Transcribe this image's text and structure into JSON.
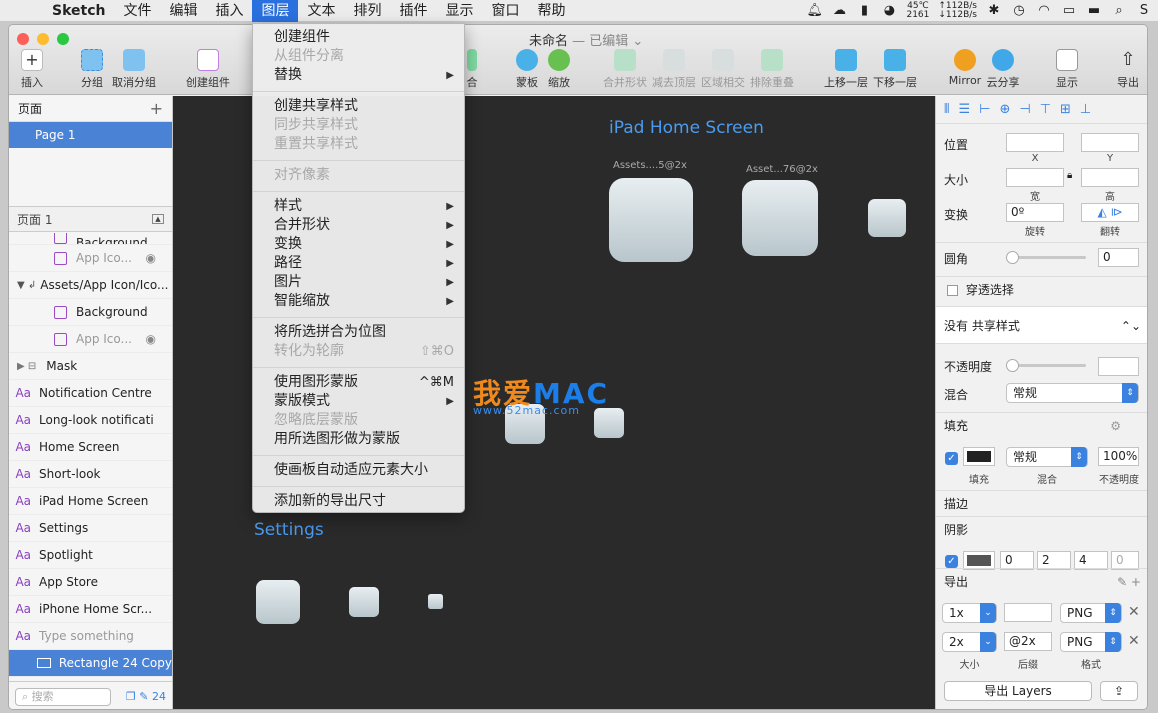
{
  "menubar": {
    "app": "Sketch",
    "items": [
      "文件",
      "编辑",
      "插入",
      "图层",
      "文本",
      "排列",
      "插件",
      "显示",
      "窗口",
      "帮助"
    ],
    "active": "图层",
    "status": {
      "temp": "45℃",
      "rpm": "2161",
      "net_up": "↑112B/s",
      "net_down": "↓112B/s"
    }
  },
  "window": {
    "title": "未命名",
    "subtitle": "— 已编辑 ⌄",
    "toolbar": {
      "insert": "插入",
      "group": "分组",
      "ungroup": "取消分组",
      "create_symbol": "创建组件",
      "merge_hidden": "合",
      "mask": "蒙板",
      "scale": "缩放",
      "union": "合并形状",
      "subtract": "减去顶层",
      "intersect": "区域相交",
      "difference": "排除重叠",
      "forward": "上移一层",
      "backward": "下移一层",
      "mirror": "Mirror",
      "cloud": "云分享",
      "view": "显示",
      "export": "导出"
    }
  },
  "left_panel": {
    "pages_title": "页面",
    "add_icon": "+",
    "page": "Page 1",
    "page_dropdown": "页面 1",
    "layers": [
      {
        "type": "rect",
        "name": "Background",
        "indent": 1,
        "partial": true
      },
      {
        "type": "rect",
        "name": "App Ico...",
        "indent": 1,
        "gray": true,
        "eye": true
      },
      {
        "type": "group",
        "name": "Assets/App Icon/Ico..."
      },
      {
        "type": "rect",
        "name": "Background",
        "indent": 1
      },
      {
        "type": "rect",
        "name": "App Ico...",
        "indent": 1,
        "gray": true,
        "eye": true
      },
      {
        "type": "mask",
        "name": "Mask"
      },
      {
        "type": "text",
        "name": "Notification Centre"
      },
      {
        "type": "text",
        "name": "Long-look notificati"
      },
      {
        "type": "text",
        "name": "Home Screen"
      },
      {
        "type": "text",
        "name": "Short-look"
      },
      {
        "type": "text",
        "name": "iPad Home Screen"
      },
      {
        "type": "text",
        "name": "Settings"
      },
      {
        "type": "text",
        "name": "Spotlight"
      },
      {
        "type": "text",
        "name": "App Store"
      },
      {
        "type": "text",
        "name": "iPhone Home Scr..."
      },
      {
        "type": "text",
        "name": "Type something",
        "gray": true
      },
      {
        "type": "rect-selected",
        "name": "Rectangle 24 Copy"
      }
    ],
    "search_placeholder": "搜索",
    "count": "24"
  },
  "canvas": {
    "ipad_label": "iPad Home Screen",
    "asset1": "Assets....5@2x",
    "asset2": "Asset...76@2x",
    "settings_label": "Settings",
    "watermark_a": "我爱",
    "watermark_b": "MAC",
    "watermark_url": "www.52mac.com"
  },
  "menu": {
    "items": [
      {
        "label": "创建组件",
        "disabled": false
      },
      {
        "label": "从组件分离",
        "disabled": true
      },
      {
        "label": "替换",
        "submenu": true
      },
      {
        "sep": true
      },
      {
        "label": "创建共享样式"
      },
      {
        "label": "同步共享样式",
        "disabled": true
      },
      {
        "label": "重置共享样式",
        "disabled": true
      },
      {
        "sep": true
      },
      {
        "label": "对齐像素",
        "disabled": true
      },
      {
        "sep": true
      },
      {
        "label": "样式",
        "submenu": true
      },
      {
        "label": "合并形状",
        "submenu": true
      },
      {
        "label": "变换",
        "submenu": true
      },
      {
        "label": "路径",
        "submenu": true
      },
      {
        "label": "图片",
        "submenu": true
      },
      {
        "label": "智能缩放",
        "submenu": true
      },
      {
        "sep": true
      },
      {
        "label": "将所选拼合为位图"
      },
      {
        "label": "转化为轮廓",
        "disabled": true,
        "shortcut": "⇧⌘O"
      },
      {
        "sep": true
      },
      {
        "label": "使用图形蒙版",
        "shortcut": "^⌘M"
      },
      {
        "label": "蒙版模式",
        "submenu": true
      },
      {
        "label": "忽略底层蒙版",
        "disabled": true
      },
      {
        "label": "用所选图形做为蒙版"
      },
      {
        "sep": true
      },
      {
        "label": "使画板自动适应元素大小"
      },
      {
        "sep": true
      },
      {
        "label": "添加新的导出尺寸"
      }
    ]
  },
  "inspector": {
    "position": "位置",
    "x": "X",
    "y": "Y",
    "size": "大小",
    "width": "宽",
    "height": "高",
    "transform": "变换",
    "rotate_value": "0º",
    "rotate": "旋转",
    "flip": "翻转",
    "radius": "圆角",
    "radius_value": "0",
    "click_through": "穿透选择",
    "shared_style": "没有 共享样式",
    "opacity": "不透明度",
    "blend": "混合",
    "blend_value": "常规",
    "fill": "填充",
    "fill_blend": "常规",
    "fill_opacity": "100%",
    "fill_cap": "填充",
    "blend_cap": "混合",
    "opacity_cap": "不透明度",
    "border": "描边",
    "shadow": "阴影",
    "shadow_values": [
      "0",
      "2",
      "4",
      "0"
    ],
    "export": "导出",
    "export_rows": [
      {
        "scale": "1x",
        "suffix": "",
        "format": "PNG"
      },
      {
        "scale": "2x",
        "suffix": "@2x",
        "format": "PNG"
      }
    ],
    "size_cap": "大小",
    "suffix_cap": "后缀",
    "format_cap": "格式",
    "export_button": "导出 Layers"
  }
}
